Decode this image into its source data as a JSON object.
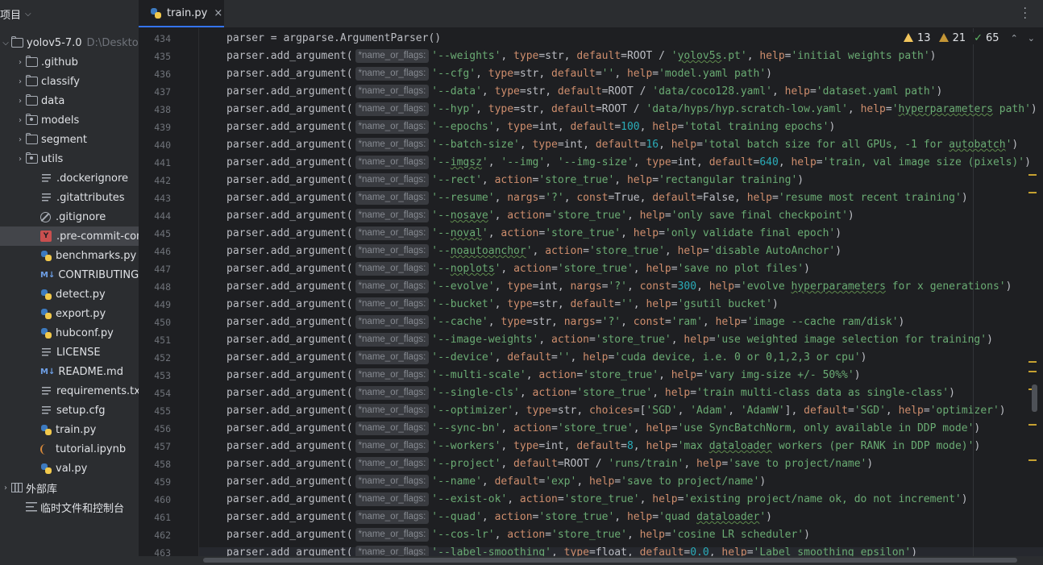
{
  "sidebar": {
    "title": "项目",
    "project": {
      "name": "yolov5-7.0",
      "path": "D:\\Deskto"
    },
    "folders": [
      ".github",
      "classify",
      "data",
      "models",
      "segment",
      "utils"
    ],
    "files": [
      {
        "name": ".dockerignore",
        "icon": "text-icon"
      },
      {
        "name": ".gitattributes",
        "icon": "text-icon"
      },
      {
        "name": ".gitignore",
        "icon": "ignore-icon"
      },
      {
        "name": ".pre-commit-confi",
        "icon": "yaml-icon",
        "selected": true
      },
      {
        "name": "benchmarks.py",
        "icon": "python-icon"
      },
      {
        "name": "CONTRIBUTING.md",
        "icon": "markdown-icon"
      },
      {
        "name": "detect.py",
        "icon": "python-icon"
      },
      {
        "name": "export.py",
        "icon": "python-icon"
      },
      {
        "name": "hubconf.py",
        "icon": "python-icon"
      },
      {
        "name": "LICENSE",
        "icon": "text-icon"
      },
      {
        "name": "README.md",
        "icon": "markdown-icon"
      },
      {
        "name": "requirements.txt",
        "icon": "text-icon"
      },
      {
        "name": "setup.cfg",
        "icon": "text-icon"
      },
      {
        "name": "train.py",
        "icon": "python-icon"
      },
      {
        "name": "tutorial.ipynb",
        "icon": "notebook-icon"
      },
      {
        "name": "val.py",
        "icon": "python-icon"
      }
    ],
    "external_libraries": "外部库",
    "scratches": "临时文件和控制台"
  },
  "tab": {
    "label": "train.py",
    "close": "×"
  },
  "inspections": {
    "warnings": "13",
    "weak_warnings": "21",
    "ok": "65"
  },
  "hint_label": "*name_or_flags:",
  "code": {
    "first_line_number": 434,
    "lines": [
      "parser = argparse.ArgumentParser()",
      "parser.add_argument( '--weights', type=str, default=ROOT / 'yolov5s.pt', help='initial weights path')",
      "parser.add_argument( '--cfg', type=str, default='', help='model.yaml path')",
      "parser.add_argument( '--data', type=str, default=ROOT / 'data/coco128.yaml', help='dataset.yaml path')",
      "parser.add_argument( '--hyp', type=str, default=ROOT / 'data/hyps/hyp.scratch-low.yaml', help='hyperparameters path')",
      "parser.add_argument( '--epochs', type=int, default=100, help='total training epochs')",
      "parser.add_argument( '--batch-size', type=int, default=16, help='total batch size for all GPUs, -1 for autobatch')",
      "parser.add_argument( '--imgsz', '--img', '--img-size', type=int, default=640, help='train, val image size (pixels)')",
      "parser.add_argument( '--rect', action='store_true', help='rectangular training')",
      "parser.add_argument( '--resume', nargs='?', const=True, default=False, help='resume most recent training')",
      "parser.add_argument( '--nosave', action='store_true', help='only save final checkpoint')",
      "parser.add_argument( '--noval', action='store_true', help='only validate final epoch')",
      "parser.add_argument( '--noautoanchor', action='store_true', help='disable AutoAnchor')",
      "parser.add_argument( '--noplots', action='store_true', help='save no plot files')",
      "parser.add_argument( '--evolve', type=int, nargs='?', const=300, help='evolve hyperparameters for x generations')",
      "parser.add_argument( '--bucket', type=str, default='', help='gsutil bucket')",
      "parser.add_argument( '--cache', type=str, nargs='?', const='ram', help='image --cache ram/disk')",
      "parser.add_argument( '--image-weights', action='store_true', help='use weighted image selection for training')",
      "parser.add_argument( '--device', default='', help='cuda device, i.e. 0 or 0,1,2,3 or cpu')",
      "parser.add_argument( '--multi-scale', action='store_true', help='vary img-size +/- 50%%')",
      "parser.add_argument( '--single-cls', action='store_true', help='train multi-class data as single-class')",
      "parser.add_argument( '--optimizer', type=str, choices=['SGD', 'Adam', 'AdamW'], default='SGD', help='optimizer')",
      "parser.add_argument( '--sync-bn', action='store_true', help='use SyncBatchNorm, only available in DDP mode')",
      "parser.add_argument( '--workers', type=int, default=8, help='max dataloader workers (per RANK in DDP mode)')",
      "parser.add_argument( '--project', default=ROOT / 'runs/train', help='save to project/name')",
      "parser.add_argument( '--name', default='exp', help='save to project/name')",
      "parser.add_argument( '--exist-ok', action='store_true', help='existing project/name ok, do not increment')",
      "parser.add_argument( '--quad', action='store_true', help='quad dataloader')",
      "parser.add_argument( '--cos-lr', action='store_true', help='cosine LR scheduler')",
      "parser.add_argument( '--label-smoothing', type=float, default=0.0, help='Label smoothing epsilon')"
    ]
  },
  "colors": {
    "accent": "#3574f0",
    "string": "#6aab73",
    "keyword": "#cf8e6d",
    "number": "#2aacb8",
    "warning": "#f2c55c"
  }
}
